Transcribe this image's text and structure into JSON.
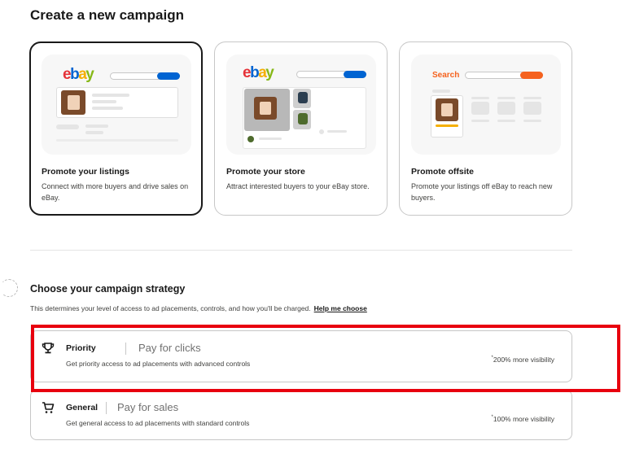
{
  "page": {
    "title": "Create a new campaign"
  },
  "campaign_types": [
    {
      "title": "Promote your listings",
      "description": "Connect with more buyers and drive sales on eBay.",
      "selected": true,
      "illustration_logo": "ebay"
    },
    {
      "title": "Promote your store",
      "description": "Attract interested buyers to your eBay store.",
      "selected": false,
      "illustration_logo": "ebay"
    },
    {
      "title": "Promote offsite",
      "description": "Promote your listings off eBay to reach new buyers.",
      "selected": false,
      "illustration_label": "Search"
    }
  ],
  "strategy": {
    "title": "Choose your campaign strategy",
    "description": "This determines your level of access to ad placements, controls, and how you'll be charged.",
    "help_link": "Help me choose",
    "options": [
      {
        "icon": "trophy-icon",
        "name": "Priority",
        "pay": "Pay for clicks",
        "description": "Get priority access to ad placements with advanced controls",
        "visibility_mark": "*",
        "visibility": "200% more visibility"
      },
      {
        "icon": "cart-icon",
        "name": "General",
        "pay": "Pay for sales",
        "description": "Get general access to ad placements with standard controls",
        "visibility_mark": "*",
        "visibility": "100% more visibility"
      }
    ]
  },
  "colors": {
    "highlight": "#e8000e",
    "ebay_red": "#e53238",
    "ebay_blue": "#0064d2",
    "ebay_yellow": "#f5af02",
    "ebay_green": "#86b817",
    "offsite_orange": "#f5621e"
  }
}
